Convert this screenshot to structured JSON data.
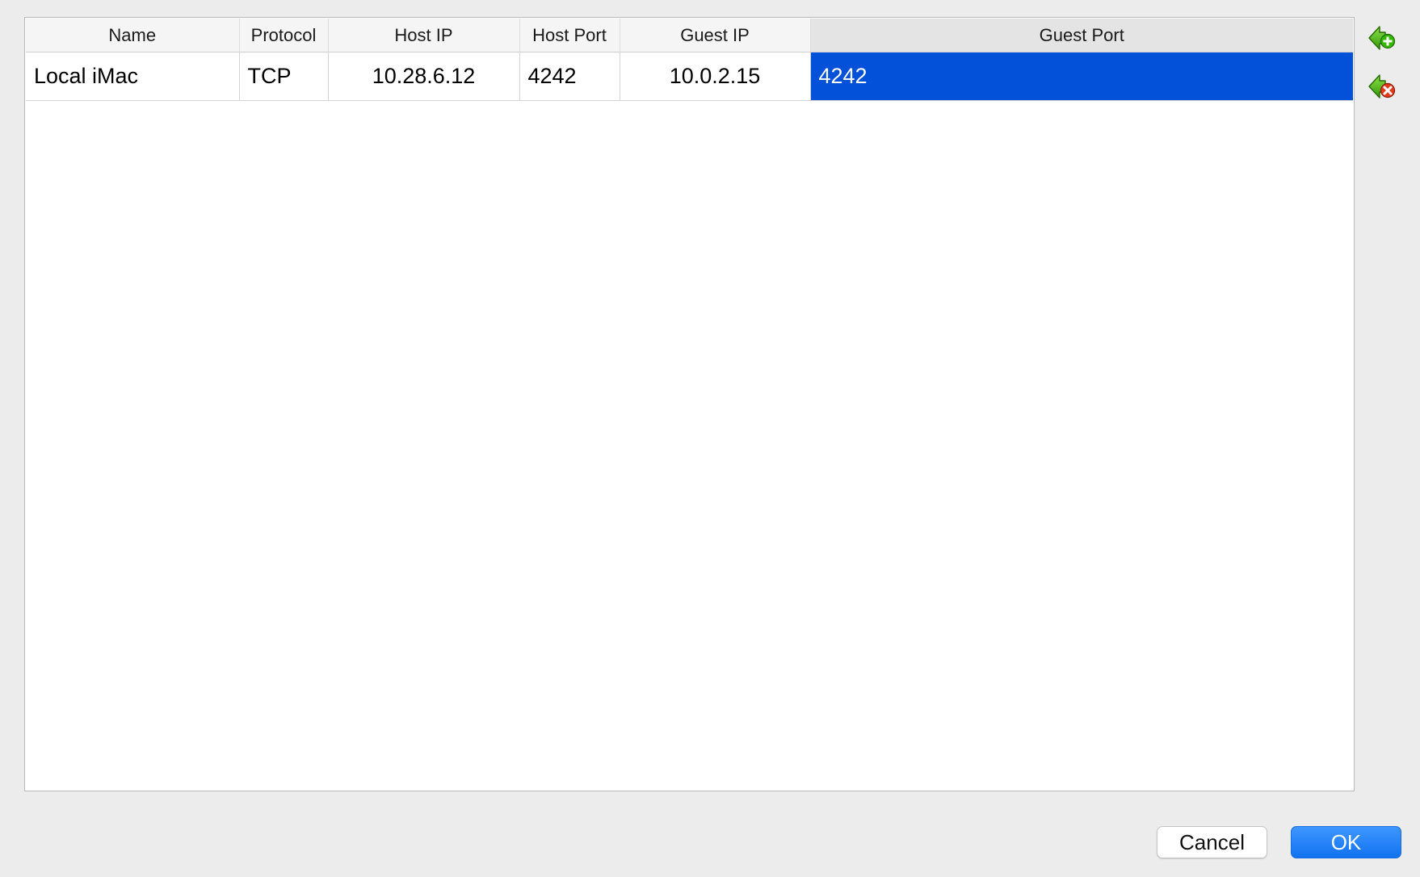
{
  "table": {
    "columns": [
      "Name",
      "Protocol",
      "Host IP",
      "Host Port",
      "Guest IP",
      "Guest Port"
    ],
    "rows": [
      {
        "name": "Local iMac",
        "protocol": "TCP",
        "host_ip": "10.28.6.12",
        "host_port": "4242",
        "guest_ip": "10.0.2.15",
        "guest_port": "4242"
      }
    ],
    "selected_column": "Guest Port"
  },
  "side_actions": {
    "add_icon": "add-rule-icon",
    "remove_icon": "remove-rule-icon"
  },
  "dialog": {
    "cancel_label": "Cancel",
    "ok_label": "OK"
  },
  "colors": {
    "selection": "#0350d9",
    "ok_button": "#1172f0",
    "add_icon_green": "#33b800",
    "remove_icon_red": "#e53a1e"
  }
}
